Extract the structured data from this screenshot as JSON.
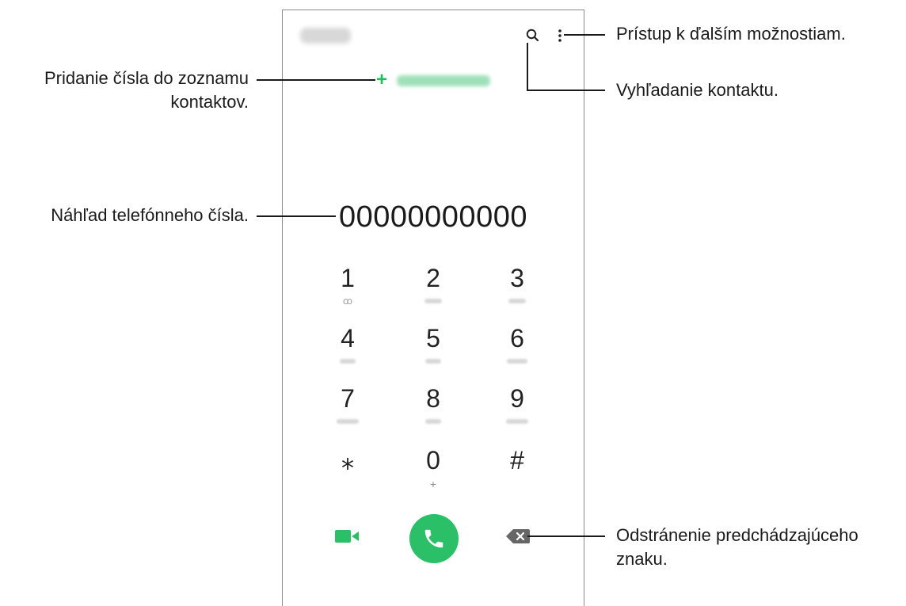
{
  "phone": {
    "number_preview": "00000000000",
    "add_contact_plus": "+",
    "keypad": [
      {
        "digit": "1",
        "sub": "voicemail"
      },
      {
        "digit": "2",
        "sub": ""
      },
      {
        "digit": "3",
        "sub": ""
      },
      {
        "digit": "4",
        "sub": ""
      },
      {
        "digit": "5",
        "sub": ""
      },
      {
        "digit": "6",
        "sub": ""
      },
      {
        "digit": "7",
        "sub": ""
      },
      {
        "digit": "8",
        "sub": ""
      },
      {
        "digit": "9",
        "sub": ""
      },
      {
        "digit": "⁎",
        "sub": ""
      },
      {
        "digit": "0",
        "sub": "+"
      },
      {
        "digit": "#",
        "sub": ""
      }
    ],
    "zero_sub": "+",
    "colors": {
      "accent": "#2bbf68",
      "outline": "#8a8a8a"
    },
    "icons": [
      "search-icon",
      "more-options-icon",
      "video-call-icon",
      "call-icon",
      "backspace-icon"
    ]
  },
  "callouts": {
    "more_options": "Prístup k ďalším možnostiam.",
    "search": "Vyhľadanie kontaktu.",
    "add_number_line1": "Pridanie čísla do zoznamu",
    "add_number_line2": "kontaktov.",
    "number_preview": "Náhľad telefónneho čísla.",
    "delete_line1": "Odstránenie predchádzajúceho",
    "delete_line2": "znaku."
  }
}
